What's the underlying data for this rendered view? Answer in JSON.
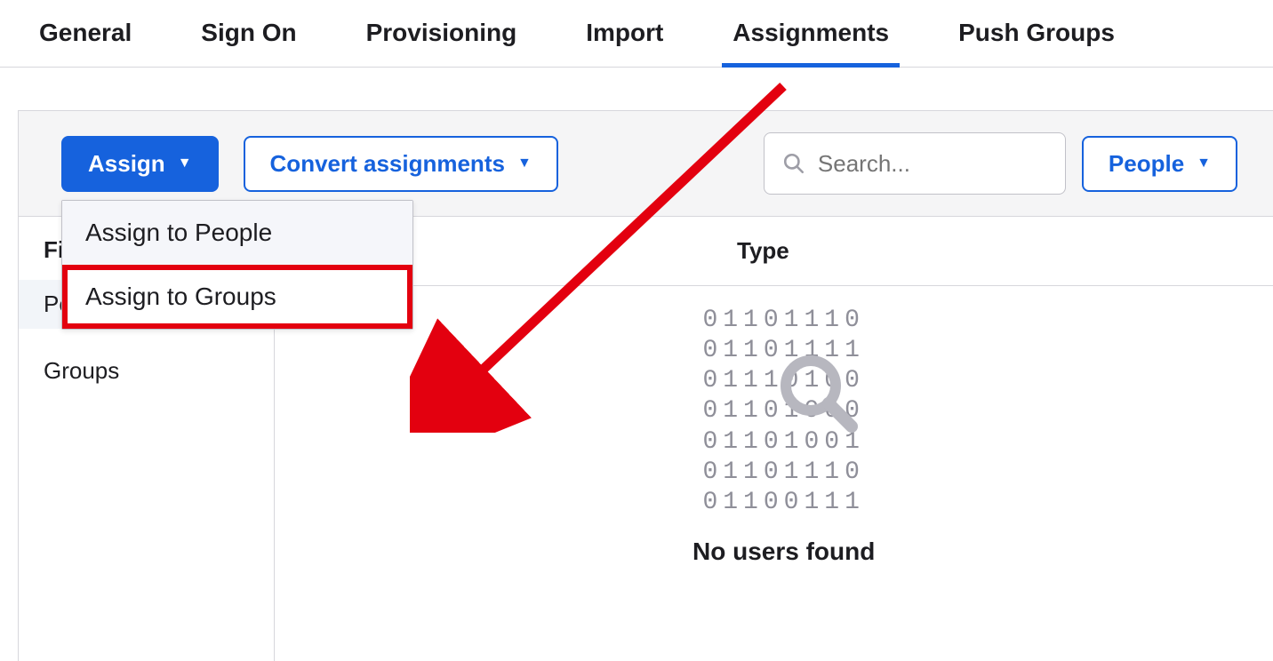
{
  "tabs": {
    "general": "General",
    "sign_on": "Sign On",
    "provisioning": "Provisioning",
    "import": "Import",
    "assignments": "Assignments",
    "push_groups": "Push Groups"
  },
  "toolbar": {
    "assign_label": "Assign",
    "convert_label": "Convert assignments",
    "people_label": "People"
  },
  "search": {
    "placeholder": "Search..."
  },
  "dropdown": {
    "assign_people": "Assign to People",
    "assign_groups": "Assign to Groups"
  },
  "sidebar": {
    "filters_title": "Filters",
    "people": "People",
    "groups": "Groups"
  },
  "table": {
    "type_header": "Type"
  },
  "empty": {
    "binary_lines": [
      "01101110",
      "01101111",
      "01110100",
      "01101000",
      "01101001",
      "01101110",
      "01100111"
    ],
    "message": "No users found"
  }
}
